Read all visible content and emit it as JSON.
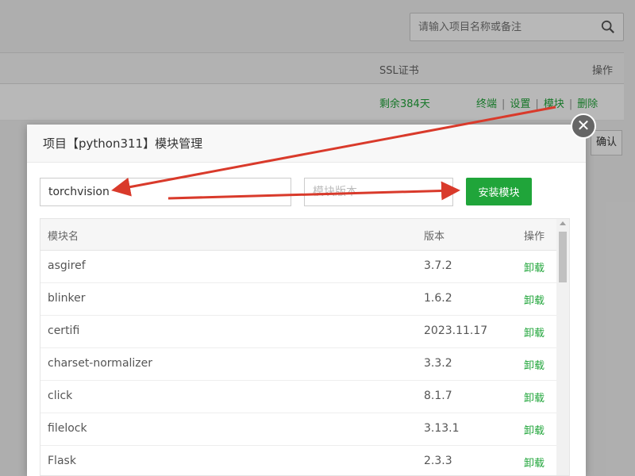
{
  "background": {
    "search_placeholder": "请输入项目名称或备注",
    "table_headers": {
      "ssl": "SSL证书",
      "actions": "操作"
    },
    "row": {
      "remaining": "剩余384天",
      "ops": [
        "终端",
        "设置",
        "模块",
        "删除"
      ]
    },
    "confirm_label": "确认"
  },
  "modal": {
    "title": "项目【python311】模块管理",
    "close_icon": "close-icon",
    "module_name_value": "torchvision",
    "module_version_placeholder": "模块版本",
    "install_label": "安装模块",
    "columns": {
      "name": "模块名",
      "version": "版本",
      "action": "操作"
    },
    "rows": [
      {
        "name": "asgiref",
        "version": "3.7.2",
        "action": "卸载"
      },
      {
        "name": "blinker",
        "version": "1.6.2",
        "action": "卸载"
      },
      {
        "name": "certifi",
        "version": "2023.11.17",
        "action": "卸载"
      },
      {
        "name": "charset-normalizer",
        "version": "3.3.2",
        "action": "卸载"
      },
      {
        "name": "click",
        "version": "8.1.7",
        "action": "卸载"
      },
      {
        "name": "filelock",
        "version": "3.13.1",
        "action": "卸载"
      },
      {
        "name": "Flask",
        "version": "2.3.3",
        "action": "卸载"
      }
    ]
  },
  "colors": {
    "accent": "#20a53a",
    "arrow": "#d93a2b"
  }
}
